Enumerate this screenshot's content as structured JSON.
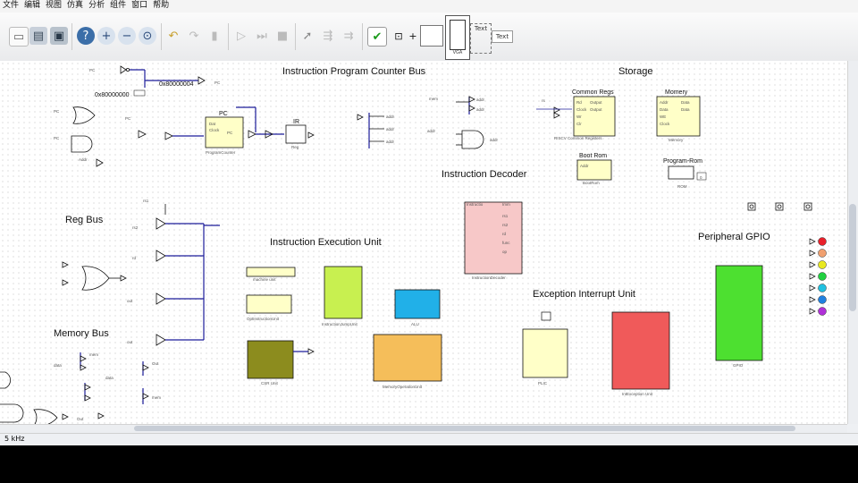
{
  "menu": [
    "文件",
    "编辑",
    "视图",
    "仿真",
    "分析",
    "组件",
    "窗口",
    "帮助"
  ],
  "toolbar": {
    "text_tool_label": "Text",
    "text_button_label": "Text",
    "vga_label": "VGA",
    "icons": [
      "new-icon",
      "open-icon",
      "save-icon",
      "help-icon",
      "zoom-in-icon",
      "zoom-out-icon",
      "zoom-fit-icon",
      "undo-icon",
      "redo-icon",
      "delete-icon",
      "play-icon",
      "step-icon",
      "stop-icon",
      "select-icon",
      "wire-icon",
      "tick-icon",
      "check-icon",
      "io-icon",
      "add-icon"
    ]
  },
  "sections": {
    "ipc_bus": "Instruction Program Counter Bus",
    "storage": "Storage",
    "decoder": "Instruction Decoder",
    "reg_bus": "Reg Bus",
    "exec_unit": "Instruction Execution Unit",
    "peripheral": "Peripheral GPIO",
    "memory_bus": "Memory Bus",
    "exception": "Exception Interrupt Unit"
  },
  "constants": {
    "c1": "0x80000004",
    "c2": "0x80000000"
  },
  "components": {
    "pc": "PC",
    "ir": "IR",
    "common_regs": "Common Regs",
    "memory": "Momery",
    "boot_rom": "Boot Rom",
    "program_rom": "Program-Rom"
  },
  "status": {
    "frequency": "5 kHz"
  },
  "colors": {
    "yellow_block": "#ffffc8",
    "decoder": "#f7c8c8",
    "alu": "#21b0e8",
    "green_block": "#c8f050",
    "olive_block": "#8c8c1e",
    "orange_block": "#f5be5a",
    "red_block": "#f05a5a",
    "gpio": "#4de030",
    "wire": "#1c1c9a"
  },
  "gpio_leds": [
    "#e8202a",
    "#f0a070",
    "#e8e820",
    "#20d040",
    "#20c0e0",
    "#2080e0",
    "#b030d8"
  ]
}
